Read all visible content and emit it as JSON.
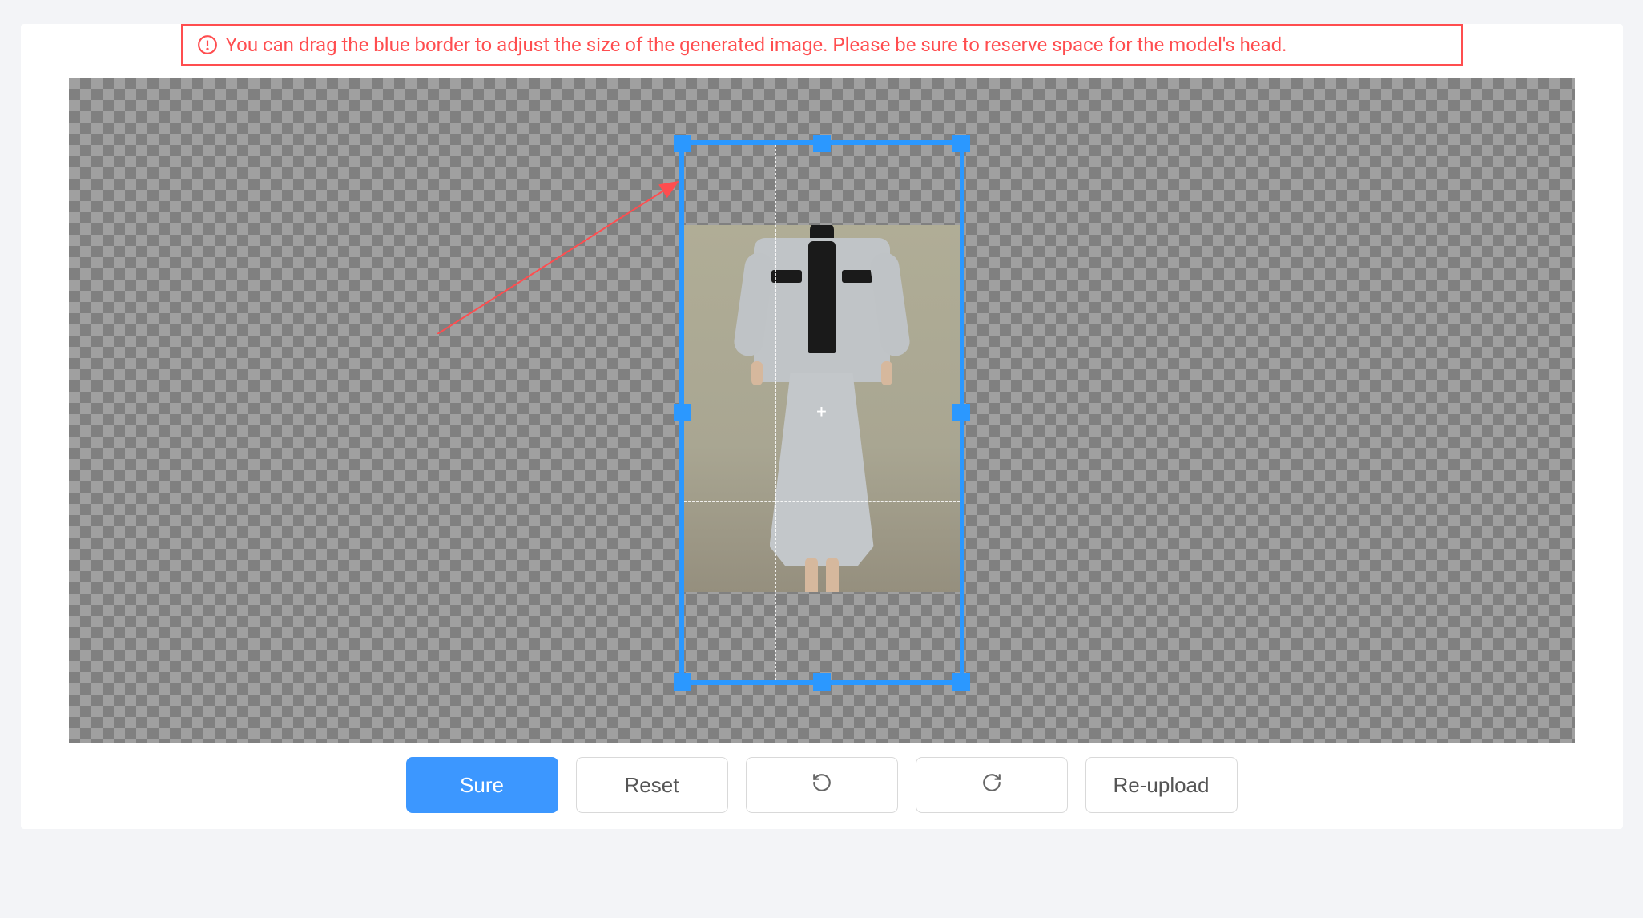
{
  "alert": {
    "text": "You can drag the blue border to adjust the size of the generated image. Please be sure to reserve space for the model's head.",
    "icon": "exclamation-circle-icon",
    "color": "#ff4d4f"
  },
  "canvas": {
    "cropFrame": {
      "borderColor": "#2b98ff",
      "handleColor": "#2b98ff"
    },
    "annotationArrowColor": "#ff4d4f"
  },
  "toolbar": {
    "sure_label": "Sure",
    "reset_label": "Reset",
    "rotate_left_icon": "rotate-left-icon",
    "rotate_right_icon": "rotate-right-icon",
    "reupload_label": "Re-upload"
  }
}
